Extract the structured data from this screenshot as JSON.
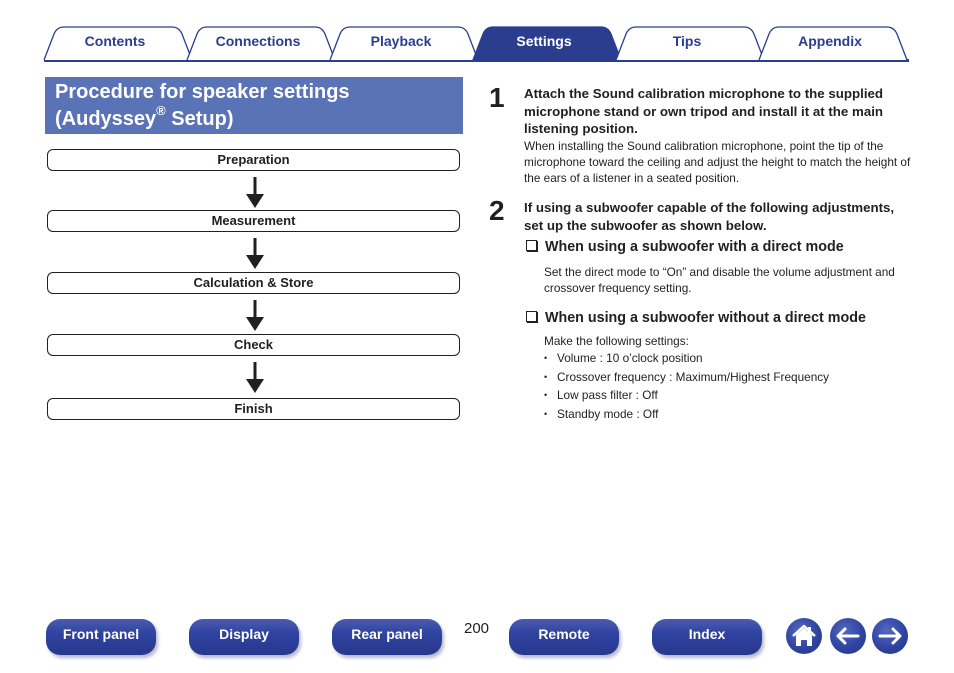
{
  "tabs": [
    {
      "label": "Contents",
      "active": false
    },
    {
      "label": "Connections",
      "active": false
    },
    {
      "label": "Playback",
      "active": false
    },
    {
      "label": "Settings",
      "active": true
    },
    {
      "label": "Tips",
      "active": false
    },
    {
      "label": "Appendix",
      "active": false
    }
  ],
  "title": {
    "line1": "Procedure for speaker settings",
    "line2_pre": "(Audyssey",
    "line2_sup": "®",
    "line2_post": " Setup)"
  },
  "flow": [
    "Preparation",
    "Measurement",
    "Calculation & Store",
    "Check",
    "Finish"
  ],
  "steps": [
    {
      "number": "1",
      "heading": "Attach the Sound calibration microphone to the supplied microphone stand or own tripod and install it at the main listening position.",
      "body": "When installing the Sound calibration microphone, point the tip of the microphone toward the ceiling and adjust the height to match the height of the ears of a listener in a seated position."
    },
    {
      "number": "2",
      "heading": "If using a subwoofer capable of the following adjustments, set up the subwoofer as shown below.",
      "sections": [
        {
          "heading": "When using a subwoofer with a direct mode",
          "body": "Set the direct mode to “On” and disable the volume adjustment and crossover frequency setting."
        },
        {
          "heading": "When using a subwoofer without a direct mode",
          "body": "Make the following settings:",
          "bullets": [
            "Volume : 10 o’clock position",
            "Crossover frequency : Maximum/Highest Frequency",
            "Low pass filter : Off",
            "Standby mode : Off"
          ]
        }
      ]
    }
  ],
  "footer": {
    "page_number": "200",
    "buttons": [
      "Front panel",
      "Display",
      "Rear panel",
      "Remote",
      "Index"
    ],
    "icons": [
      "home-icon",
      "back-arrow-icon",
      "forward-arrow-icon"
    ]
  },
  "colors": {
    "accent": "#2b3d8f",
    "title_bg": "#5a72b6"
  }
}
